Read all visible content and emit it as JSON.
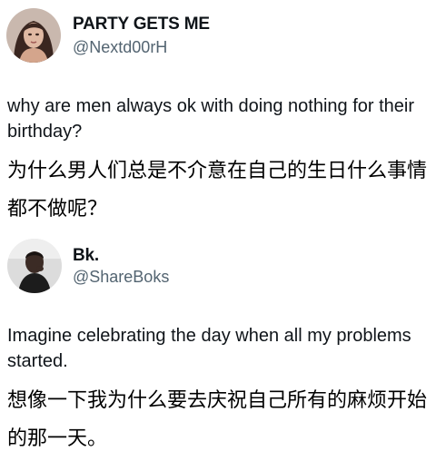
{
  "posts": [
    {
      "display_name": "PARTY GETS ME",
      "handle": "@Nextd00rH",
      "avatar_icon": "woman-portrait-avatar",
      "text_en": "why are men always ok with doing nothing for their birthday?",
      "text_zh": "为什么男人们总是不介意在自己的生日什么事情都不做呢？"
    },
    {
      "display_name": "Bk.",
      "handle": "@ShareBoks",
      "avatar_icon": "man-portrait-avatar",
      "text_en": "Imagine celebrating the day when all my problems started.",
      "text_zh": "想像一下我为什么要去庆祝自己所有的麻烦开始的那一天。"
    }
  ],
  "colors": {
    "text": "#0f1419",
    "handle": "#536471",
    "background": "#ffffff"
  }
}
